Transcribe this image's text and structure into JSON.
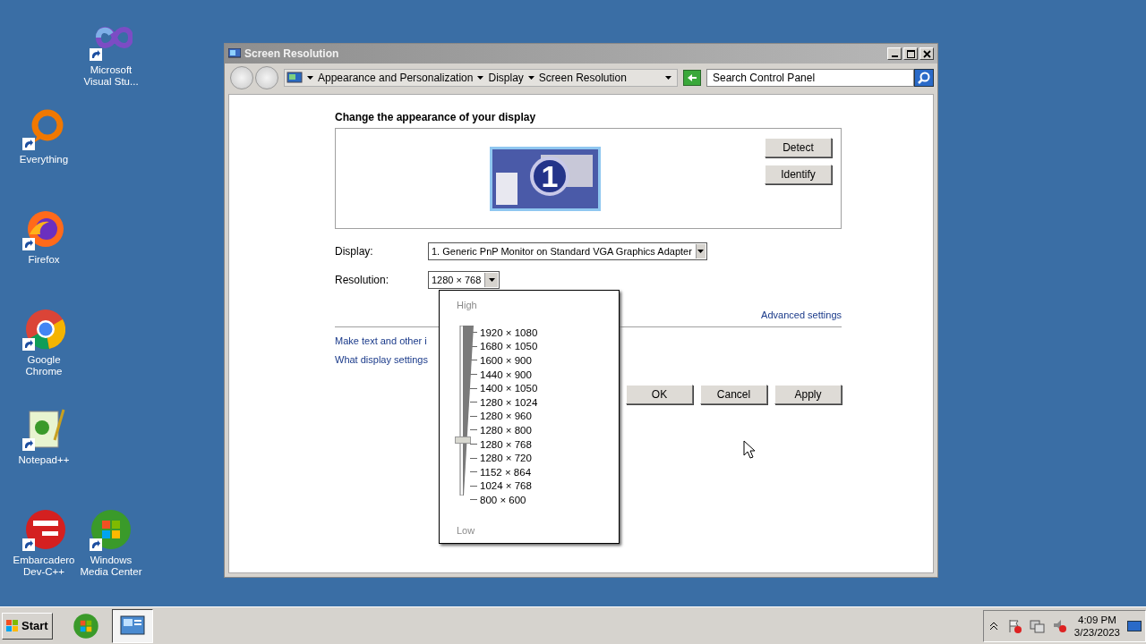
{
  "desktop": {
    "icons": [
      {
        "kind": "infinity",
        "label": "Microsoft Visual Stu..."
      },
      {
        "kind": "ring",
        "label": "Everything"
      },
      {
        "kind": "fox",
        "label": "Firefox"
      },
      {
        "kind": "chrome",
        "label": "Google Chrome"
      },
      {
        "kind": "notepad",
        "label": "Notepad++"
      },
      {
        "kind": "devball",
        "label": "Embarcadero Dev-C++"
      },
      {
        "kind": "orb",
        "label": "Windows Media Center"
      }
    ]
  },
  "window": {
    "title": "Screen Resolution",
    "breadcrumbs": [
      "Appearance and Personalization",
      "Display",
      "Screen Resolution"
    ],
    "search": {
      "placeholder": "Search Control Panel"
    },
    "heading": "Change the appearance of your display",
    "monitor_number": "1",
    "side_buttons": [
      "Detect",
      "Identify"
    ],
    "display": {
      "label": "Display:",
      "value": "1. Generic PnP Monitor on Standard VGA Graphics Adapter"
    },
    "resolution": {
      "label": "Resolution:",
      "value": "1280 × 768",
      "expanded": true,
      "popup": {
        "high": "High",
        "low": "Low",
        "level": 0.333,
        "options": [
          "1920 × 1080",
          "1680 × 1050",
          "1600 × 900",
          "1440 × 900",
          "1400 × 1050",
          "1280 × 1024",
          "1280 × 960",
          "1280 × 800",
          "1280 × 768",
          "1280 × 720",
          "1152 × 864",
          "1024 × 768",
          "800 × 600"
        ]
      }
    },
    "advanced_link": "Advanced settings",
    "links": [
      "Make text and other i",
      "What display settings"
    ],
    "buttons": [
      "OK",
      "Cancel",
      "Apply"
    ]
  },
  "taskbar": {
    "start": "Start",
    "tasks": [
      {
        "kind": "orb",
        "selected": false
      },
      {
        "kind": "panel",
        "selected": true
      }
    ],
    "time": "4:09 PM",
    "date": "3/23/2023"
  }
}
